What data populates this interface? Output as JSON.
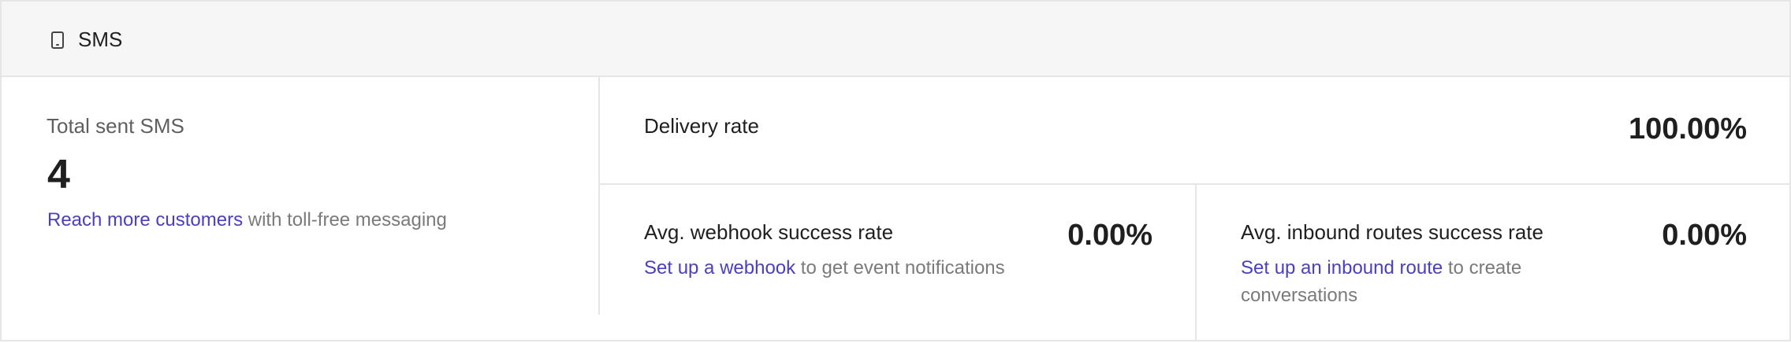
{
  "header": {
    "icon": "mobile-phone-icon",
    "title": "SMS"
  },
  "total_sent": {
    "label": "Total sent SMS",
    "value": "4",
    "cta_link": "Reach more customers",
    "cta_text": " with toll-free messaging"
  },
  "delivery_rate": {
    "label": "Delivery rate",
    "value": "100.00%"
  },
  "webhook": {
    "label": "Avg. webhook success rate",
    "value": "0.00%",
    "cta_link": "Set up a webhook",
    "cta_text": " to get event notifications"
  },
  "inbound_routes": {
    "label": "Avg. inbound routes success rate",
    "value": "0.00%",
    "cta_link": "Set up an inbound route",
    "cta_text": " to create conversations"
  },
  "colors": {
    "link": "#4a3fbf",
    "header_bg": "#f6f6f6",
    "border": "#e6e6e6",
    "muted_text": "#7a7a7a"
  }
}
